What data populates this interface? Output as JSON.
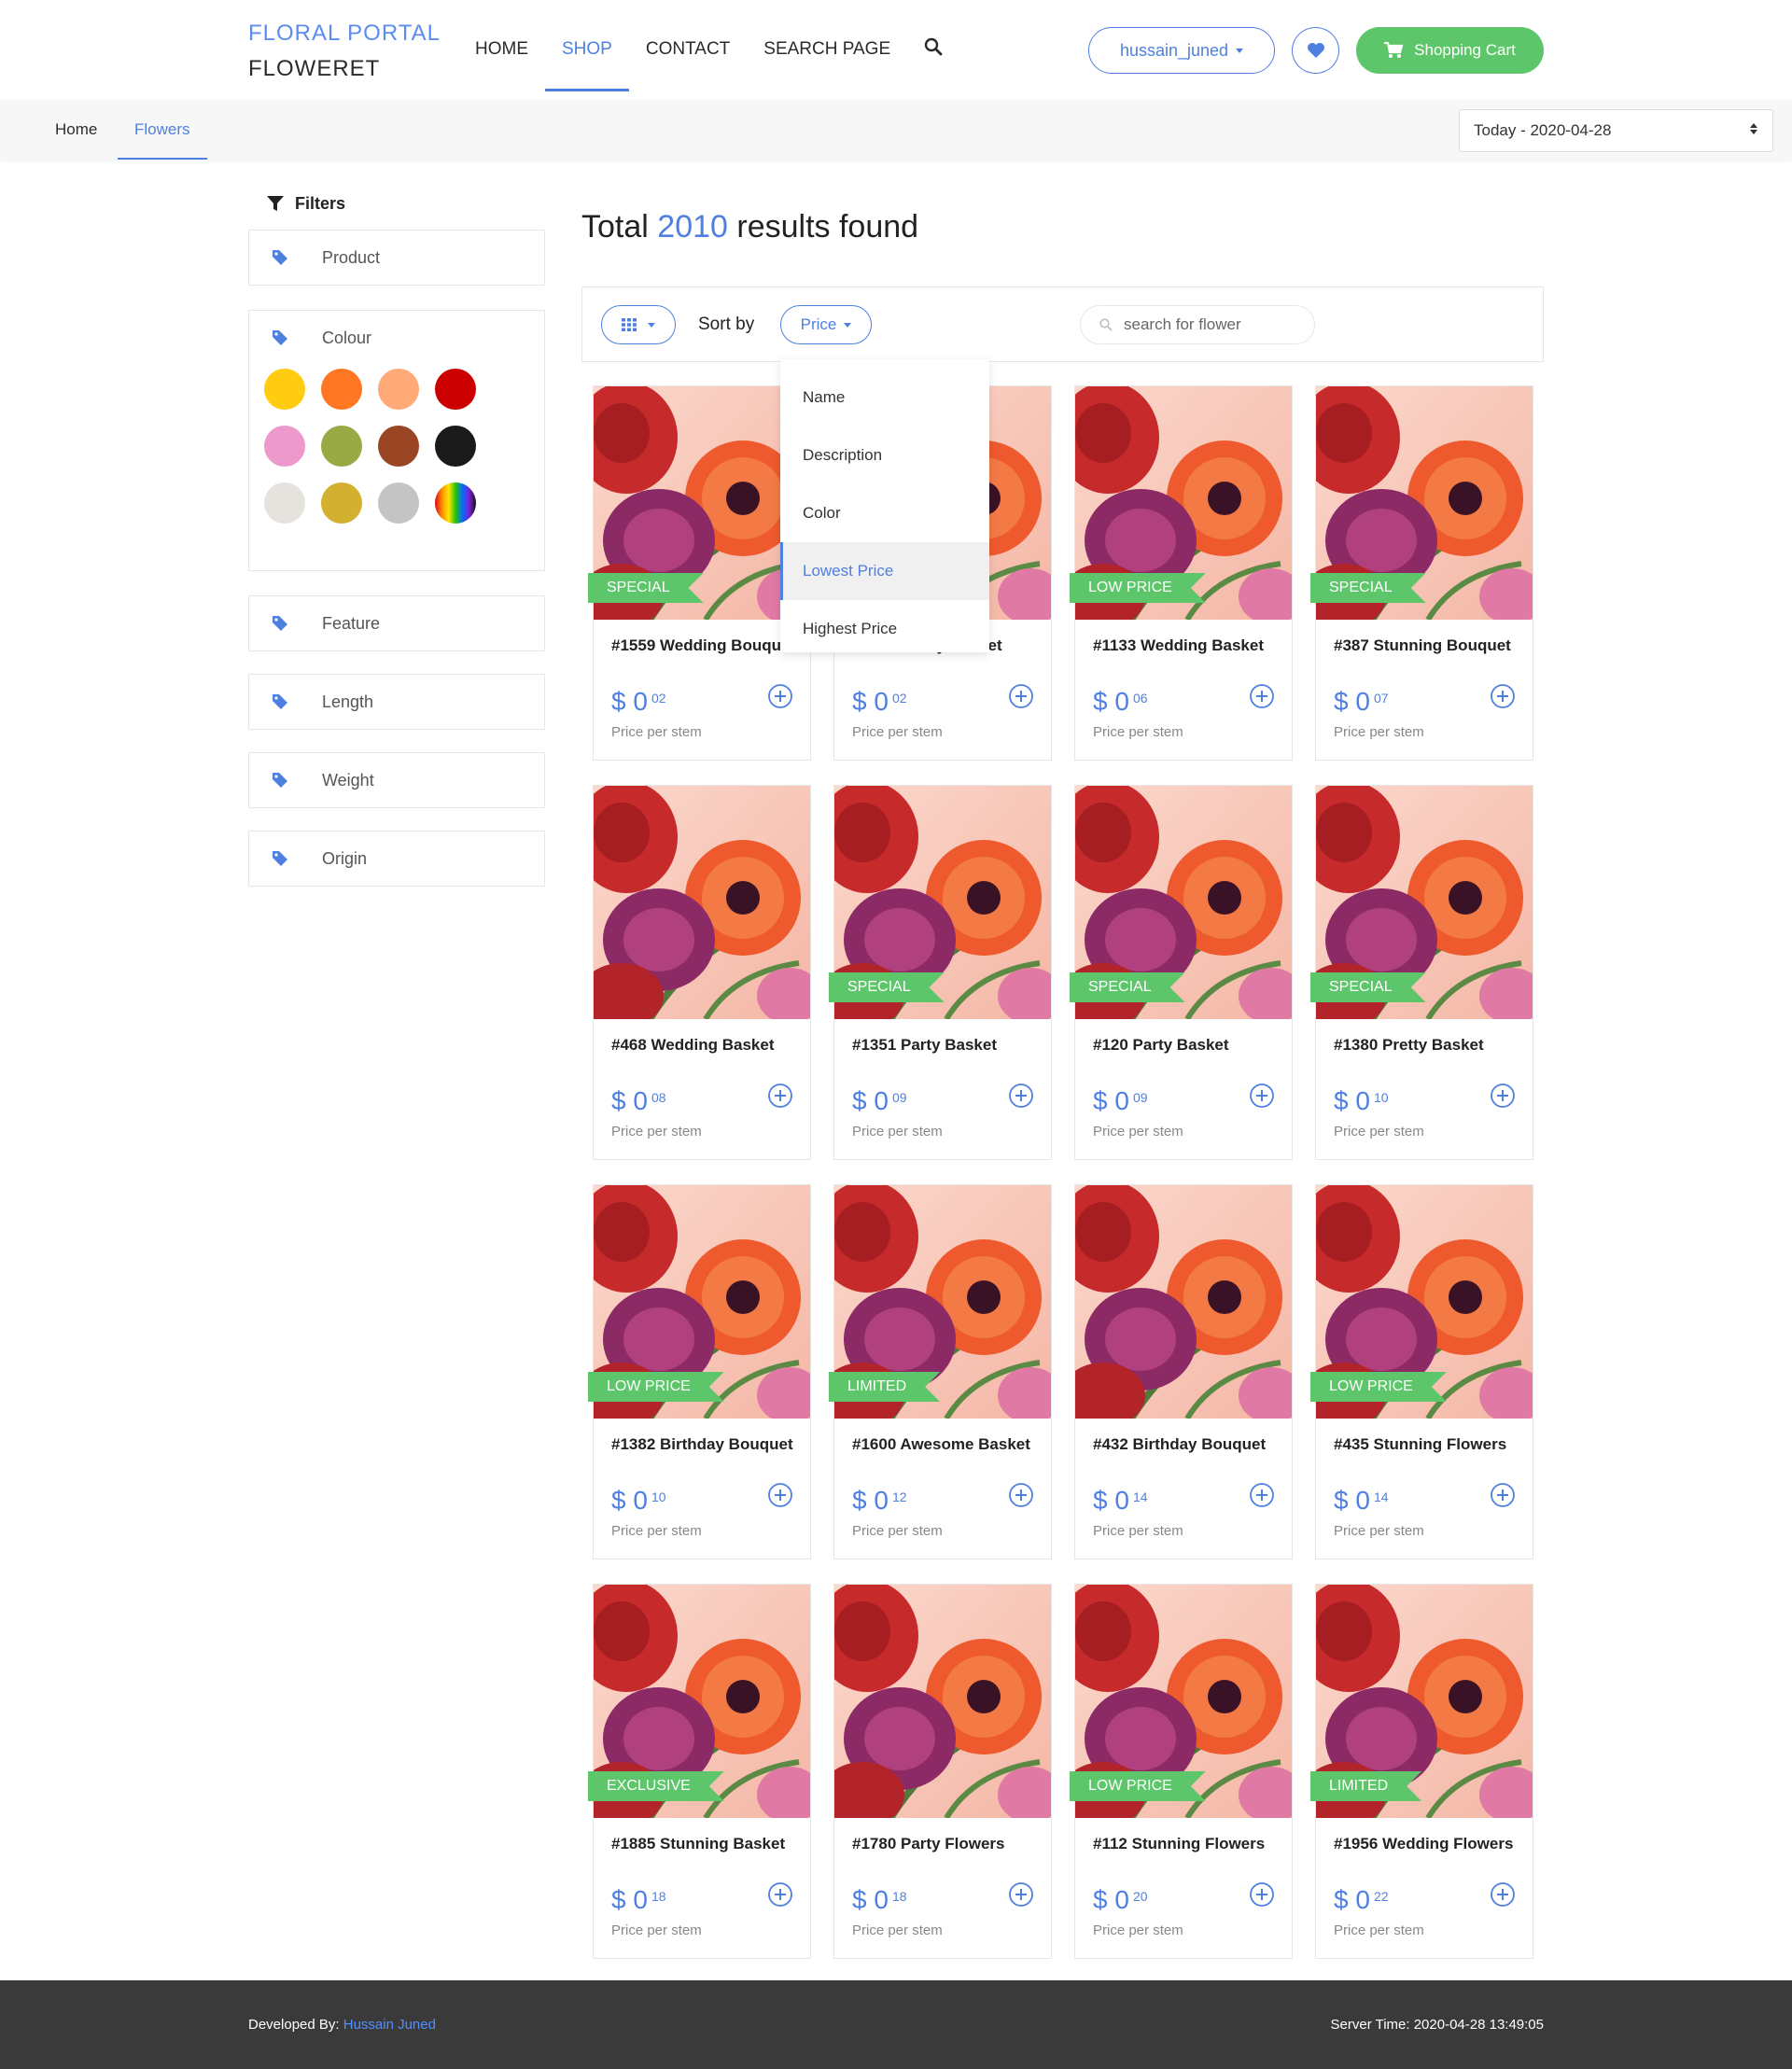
{
  "brand": {
    "line1": "FLORAL PORTAL",
    "line2": "FLOWERET"
  },
  "nav": {
    "items": [
      {
        "label": "HOME",
        "active": false
      },
      {
        "label": "SHOP",
        "active": true
      },
      {
        "label": "CONTACT",
        "active": false
      },
      {
        "label": "SEARCH PAGE",
        "active": false
      }
    ]
  },
  "header": {
    "username": "hussain_juned",
    "cart_label": "Shopping Cart"
  },
  "breadcrumb": {
    "home": "Home",
    "current": "Flowers"
  },
  "date_select": {
    "value": "Today - 2020-04-28"
  },
  "filters": {
    "title": "Filters",
    "product": "Product",
    "colour": "Colour",
    "feature": "Feature",
    "length": "Length",
    "weight": "Weight",
    "origin": "Origin",
    "colours": [
      "#ffcc11",
      "#ff7722",
      "#ffaa77",
      "#cc0000",
      "#ee99cc",
      "#99aa44",
      "#994422",
      "#1a1a1a",
      "#e6e2de",
      "#d4b030",
      "#c4c4c4",
      "rainbow"
    ]
  },
  "results": {
    "prefix": "Total",
    "count": "2010",
    "suffix": "results found"
  },
  "toolbar": {
    "sort_label": "Sort by",
    "sort_value": "Price",
    "search_placeholder": "search for flower"
  },
  "sort_options": [
    {
      "label": "Name",
      "active": false
    },
    {
      "label": "Description",
      "active": false
    },
    {
      "label": "Color",
      "active": false
    },
    {
      "label": "Lowest Price",
      "active": true
    },
    {
      "label": "Highest Price",
      "active": false
    }
  ],
  "products": [
    {
      "title": "#1559 Wedding Bouquet",
      "badge": "SPECIAL",
      "currency": "$",
      "whole": "0",
      "cents": "02",
      "note": "Price per stem"
    },
    {
      "title": "#1600 Pretty Basket",
      "badge": "",
      "currency": "$",
      "whole": "0",
      "cents": "02",
      "note": "Price per stem"
    },
    {
      "title": "#1133 Wedding Basket",
      "badge": "LOW PRICE",
      "currency": "$",
      "whole": "0",
      "cents": "06",
      "note": "Price per stem"
    },
    {
      "title": "#387 Stunning Bouquet",
      "badge": "SPECIAL",
      "currency": "$",
      "whole": "0",
      "cents": "07",
      "note": "Price per stem"
    },
    {
      "title": "#468 Wedding Basket",
      "badge": "",
      "currency": "$",
      "whole": "0",
      "cents": "08",
      "note": "Price per stem"
    },
    {
      "title": "#1351 Party Basket",
      "badge": "SPECIAL",
      "currency": "$",
      "whole": "0",
      "cents": "09",
      "note": "Price per stem"
    },
    {
      "title": "#120 Party Basket",
      "badge": "SPECIAL",
      "currency": "$",
      "whole": "0",
      "cents": "09",
      "note": "Price per stem"
    },
    {
      "title": "#1380 Pretty Basket",
      "badge": "SPECIAL",
      "currency": "$",
      "whole": "0",
      "cents": "10",
      "note": "Price per stem"
    },
    {
      "title": "#1382 Birthday Bouquet",
      "badge": "LOW PRICE",
      "currency": "$",
      "whole": "0",
      "cents": "10",
      "note": "Price per stem"
    },
    {
      "title": "#1600 Awesome Basket",
      "badge": "LIMITED",
      "currency": "$",
      "whole": "0",
      "cents": "12",
      "note": "Price per stem"
    },
    {
      "title": "#432 Birthday Bouquet",
      "badge": "",
      "currency": "$",
      "whole": "0",
      "cents": "14",
      "note": "Price per stem"
    },
    {
      "title": "#435 Stunning Flowers",
      "badge": "LOW PRICE",
      "currency": "$",
      "whole": "0",
      "cents": "14",
      "note": "Price per stem"
    },
    {
      "title": "#1885 Stunning Basket",
      "badge": "EXCLUSIVE",
      "currency": "$",
      "whole": "0",
      "cents": "18",
      "note": "Price per stem"
    },
    {
      "title": "#1780 Party Flowers",
      "badge": "",
      "currency": "$",
      "whole": "0",
      "cents": "18",
      "note": "Price per stem"
    },
    {
      "title": "#112 Stunning Flowers",
      "badge": "LOW PRICE",
      "currency": "$",
      "whole": "0",
      "cents": "20",
      "note": "Price per stem"
    },
    {
      "title": "#1956 Wedding Flowers",
      "badge": "LIMITED",
      "currency": "$",
      "whole": "0",
      "cents": "22",
      "note": "Price per stem"
    }
  ],
  "footer": {
    "dev_label": "Developed By:",
    "dev_name": "Hussain Juned",
    "server_time": "Server Time: 2020-04-28 13:49:05"
  },
  "colors": {
    "accent": "#4f7fe0",
    "green": "#5dc66b",
    "footer_bg": "#3a3a3a"
  }
}
